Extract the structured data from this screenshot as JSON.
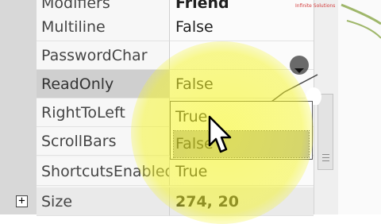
{
  "properties": [
    {
      "name": "Modifiers",
      "value": "Friend",
      "bold": true
    },
    {
      "name": "Multiline",
      "value": "False"
    },
    {
      "name": "PasswordChar",
      "value": ""
    },
    {
      "name": "ReadOnly",
      "value": "False"
    },
    {
      "name": "RightToLeft",
      "value": ""
    },
    {
      "name": "ScrollBars",
      "value": ""
    },
    {
      "name": "ShortcutsEnabled",
      "value": "True"
    },
    {
      "name": "Size",
      "value": "274, 20",
      "bold": true
    }
  ],
  "size_expand_symbol": "+",
  "dropdown": {
    "options": [
      "True",
      "False"
    ],
    "hovered_option": "False"
  },
  "watermark": {
    "text": "Infinite Solutions"
  },
  "icons": {
    "dropdown": "chevron-down-icon",
    "expand": "plus-box-icon",
    "cursor": "mouse-cursor-icon",
    "logo": "brand-logo-icon"
  },
  "colors": {
    "highlight": "#F6F628",
    "selected_row": "#CFCFCF",
    "hovered_option": "#B5B5B5"
  }
}
